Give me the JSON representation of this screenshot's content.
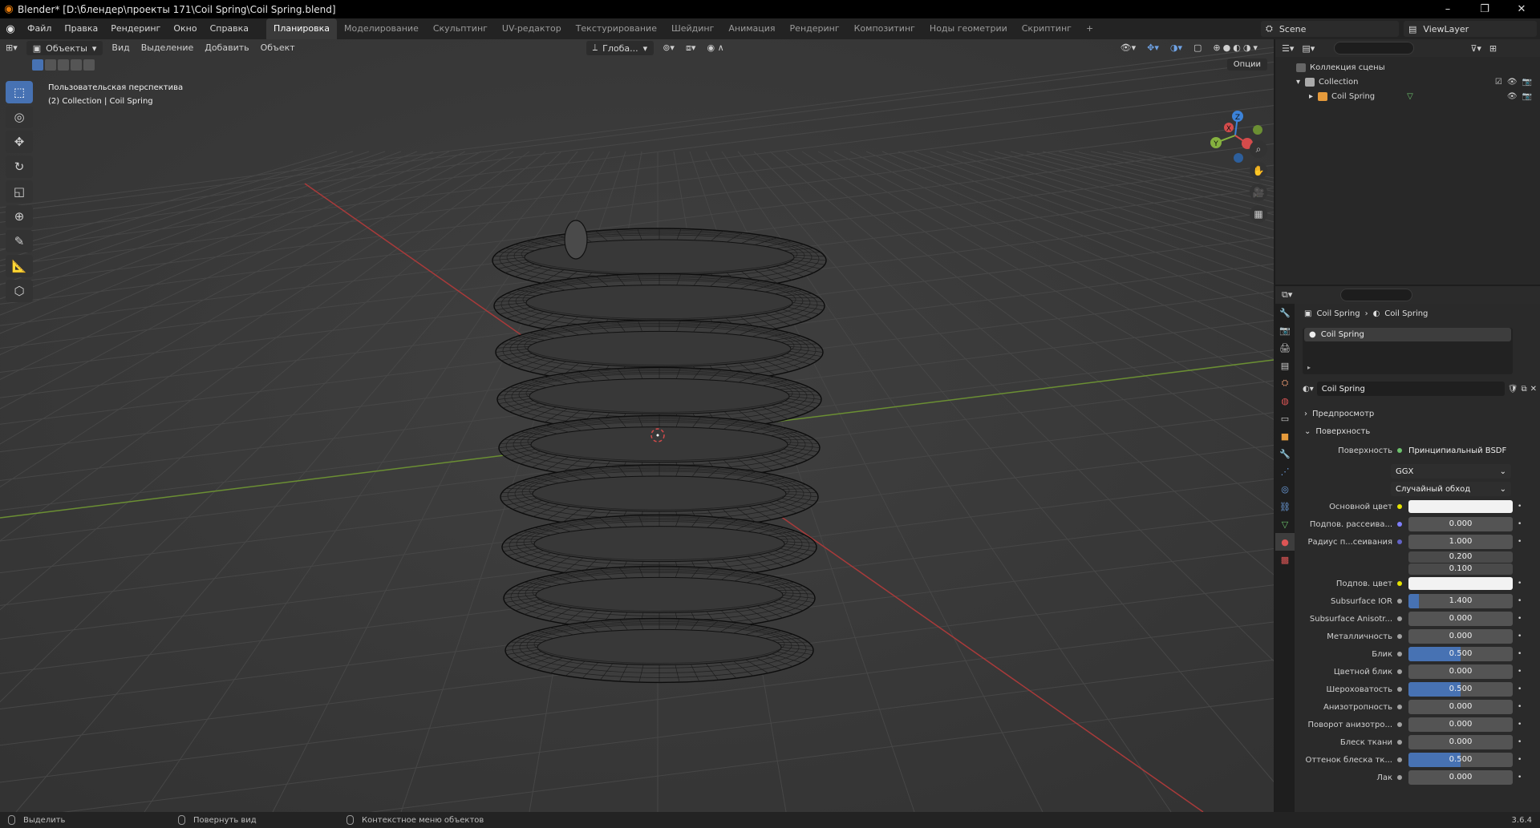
{
  "window": {
    "title": "Blender* [D:\\блендер\\проекты 171\\Coil Spring\\Coil Spring.blend]",
    "minimize": "–",
    "maximize": "❐",
    "close": "✕"
  },
  "menu": {
    "items": [
      "Файл",
      "Правка",
      "Рендеринг",
      "Окно",
      "Справка"
    ]
  },
  "workspaces": {
    "tabs": [
      "Планировка",
      "Моделирование",
      "Скульптинг",
      "UV-редактор",
      "Текстурирование",
      "Шейдинг",
      "Анимация",
      "Рендеринг",
      "Композитинг",
      "Ноды геометрии",
      "Скриптинг"
    ],
    "add": "+"
  },
  "scene": {
    "name": "Scene",
    "view_layer": "ViewLayer"
  },
  "viewport": {
    "mode": "Объекты",
    "menus": [
      "Вид",
      "Выделение",
      "Добавить",
      "Объект"
    ],
    "orientation": "Глоба...",
    "options": "Опции",
    "info_line1": "Пользовательская перспектива",
    "info_line2": "(2) Collection | Coil Spring",
    "axis_labels": {
      "x": "X",
      "y": "Y",
      "z": "Z"
    }
  },
  "tools": [
    {
      "name": "select-box-tool",
      "icon": "⬚"
    },
    {
      "name": "cursor-tool",
      "icon": "◎"
    },
    {
      "name": "move-tool",
      "icon": "✥"
    },
    {
      "name": "rotate-tool",
      "icon": "↻"
    },
    {
      "name": "scale-tool",
      "icon": "◱"
    },
    {
      "name": "transform-tool",
      "icon": "⊕"
    },
    {
      "name": "annotate-tool",
      "icon": "✎"
    },
    {
      "name": "measure-tool",
      "icon": "📐"
    },
    {
      "name": "add-cube-tool",
      "icon": "⬡"
    }
  ],
  "outliner": {
    "scene_collection": "Коллекция сцены",
    "collection": "Collection",
    "object": "Coil Spring"
  },
  "properties": {
    "breadcrumb_object": "Coil Spring",
    "breadcrumb_material": "Coil Spring",
    "slot_name": "Coil Spring",
    "material_name": "Coil Spring",
    "section_preview": "Предпросмотр",
    "section_surface": "Поверхность",
    "surface_label": "Поверхность",
    "surface_value": "Принципиальный BSDF",
    "distribution": "GGX",
    "subsurface_method": "Случайный обход",
    "rows": [
      {
        "label": "Основной цвет",
        "type": "color",
        "dot": "#e5e300"
      },
      {
        "label": "Подпов. рассеива...",
        "type": "value",
        "value": "0.000",
        "fill": 0,
        "dot": "#7f7fff"
      },
      {
        "label": "Радиус п...сеивания",
        "type": "value",
        "value": "1.000",
        "fill": 0,
        "dot": "#6363c7"
      },
      {
        "label": "",
        "type": "value",
        "value": "0.200",
        "fill": 0,
        "dot": ""
      },
      {
        "label": "",
        "type": "value",
        "value": "0.100",
        "fill": 0,
        "dot": ""
      },
      {
        "label": "Подпов. цвет",
        "type": "color",
        "dot": "#e5e300"
      },
      {
        "label": "Subsurface IOR",
        "type": "value",
        "value": "1.400",
        "fill": 0.1,
        "dot": "#a1a1a1"
      },
      {
        "label": "Subsurface Anisotr...",
        "type": "value",
        "value": "0.000",
        "fill": 0,
        "dot": "#a1a1a1"
      },
      {
        "label": "Металличность",
        "type": "value",
        "value": "0.000",
        "fill": 0,
        "dot": "#a1a1a1"
      },
      {
        "label": "Блик",
        "type": "value",
        "value": "0.500",
        "fill": 0.5,
        "dot": "#a1a1a1"
      },
      {
        "label": "Цветной блик",
        "type": "value",
        "value": "0.000",
        "fill": 0,
        "dot": "#a1a1a1"
      },
      {
        "label": "Шероховатость",
        "type": "value",
        "value": "0.500",
        "fill": 0.5,
        "dot": "#a1a1a1"
      },
      {
        "label": "Анизотропность",
        "type": "value",
        "value": "0.000",
        "fill": 0,
        "dot": "#a1a1a1"
      },
      {
        "label": "Поворот анизотро...",
        "type": "value",
        "value": "0.000",
        "fill": 0,
        "dot": "#a1a1a1"
      },
      {
        "label": "Блеск ткани",
        "type": "value",
        "value": "0.000",
        "fill": 0,
        "dot": "#a1a1a1"
      },
      {
        "label": "Оттенок блеска тк...",
        "type": "value",
        "value": "0.500",
        "fill": 0.5,
        "dot": "#a1a1a1"
      },
      {
        "label": "Лак",
        "type": "value",
        "value": "0.000",
        "fill": 0,
        "dot": "#a1a1a1"
      }
    ]
  },
  "statusbar": {
    "select": "Выделить",
    "rotate": "Повернуть вид",
    "context": "Контекстное меню объектов",
    "version": "3.6.4"
  },
  "colors": {
    "accent": "#4772b3",
    "x_axis": "#d44b4b",
    "y_axis": "#85b13f",
    "z_axis": "#3c83d9"
  }
}
